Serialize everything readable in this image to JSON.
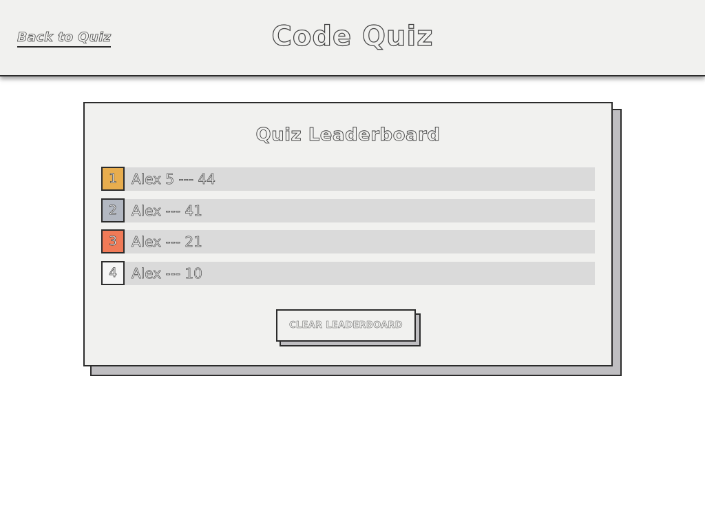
{
  "header": {
    "back_link": "Back to Quiz",
    "title": "Code Quiz"
  },
  "card": {
    "title": "Quiz Leaderboard",
    "clear_button": "CLEAR LEADERBOARD"
  },
  "leaderboard": [
    {
      "rank": "1",
      "text": "Alex 5 --- 44",
      "badge_color": "#e8ad4e"
    },
    {
      "rank": "2",
      "text": "Alex --- 41",
      "badge_color": "#b3b8c2"
    },
    {
      "rank": "3",
      "text": "Alex --- 21",
      "badge_color": "#f07a57"
    },
    {
      "rank": "4",
      "text": "Alex --- 10",
      "badge_color": "#f5f5f5"
    }
  ],
  "colors": {
    "page_background": "#ffffff",
    "panel_background": "#f1f1ef",
    "entry_bar": "#dadada",
    "shadow": "#bfbec1",
    "border": "#2b2b2b"
  }
}
